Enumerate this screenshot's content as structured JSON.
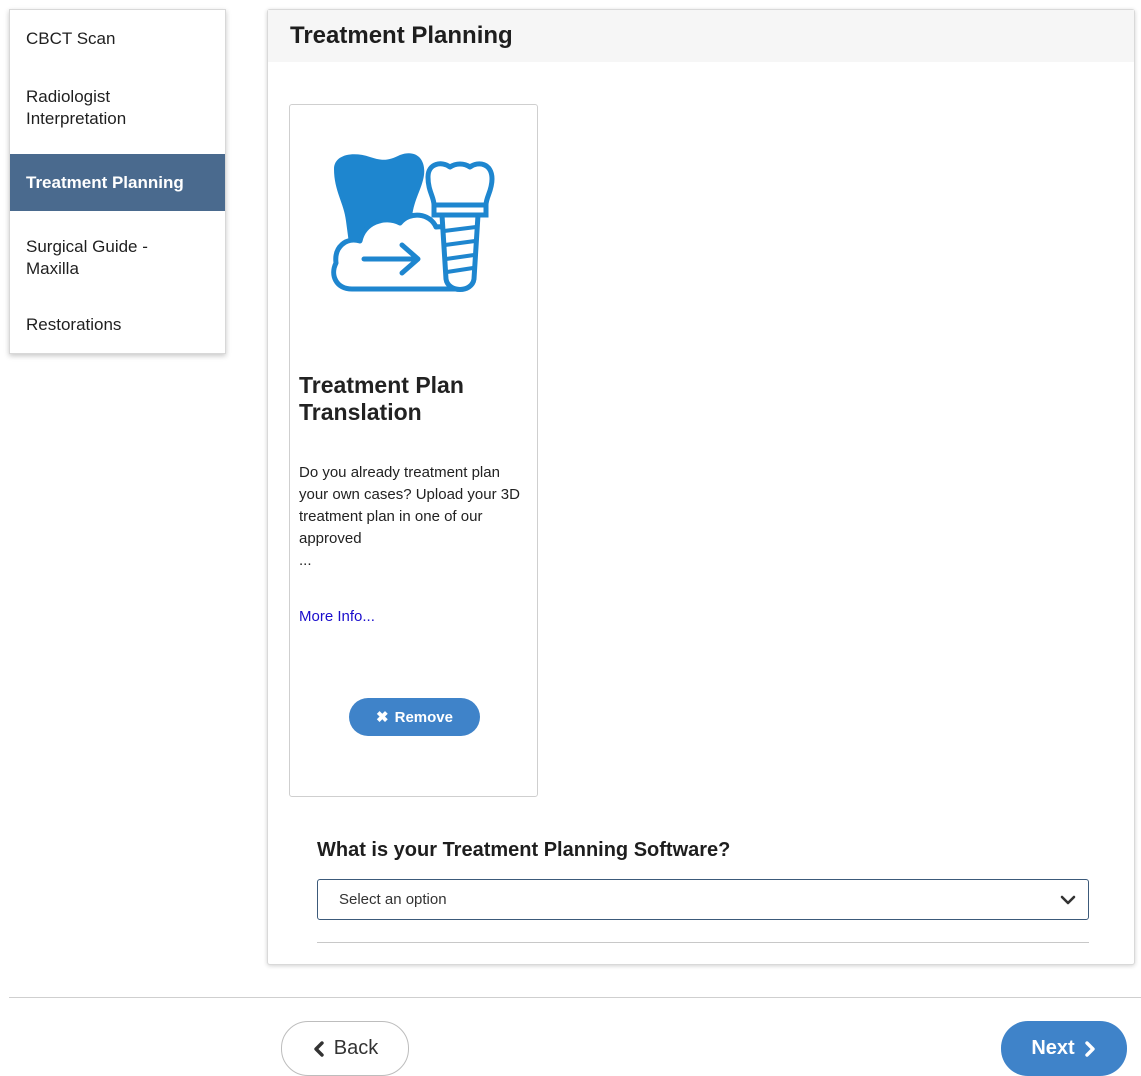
{
  "sidebar": {
    "items": [
      {
        "label": "CBCT Scan"
      },
      {
        "label": "Radiologist Interpretation"
      },
      {
        "label": "Treatment Planning"
      },
      {
        "label": "Surgical Guide - Maxilla"
      },
      {
        "label": "Restorations"
      }
    ],
    "active_index": 2
  },
  "panel": {
    "title": "Treatment Planning",
    "card": {
      "icon": "cloud-implant-transfer-icon",
      "title": "Treatment Plan Translation",
      "description": "Do you already treatment plan your own cases? Upload your 3D treatment plan in one of our approved",
      "ellipsis": "...",
      "more_link": "More Info...",
      "remove_label": "Remove",
      "remove_icon": "close-icon"
    },
    "question": "What is your Treatment Planning Software?",
    "select": {
      "value": "Select an option",
      "icon": "chevron-down-icon"
    }
  },
  "footer": {
    "back_label": "Back",
    "back_icon": "chevron-left-icon",
    "next_label": "Next",
    "next_icon": "chevron-right-icon"
  },
  "colors": {
    "accent": "#3f83c9",
    "sidebar_active": "#4a6a8e",
    "link": "#1a0dcc",
    "icon_blue": "#1e86cf"
  }
}
